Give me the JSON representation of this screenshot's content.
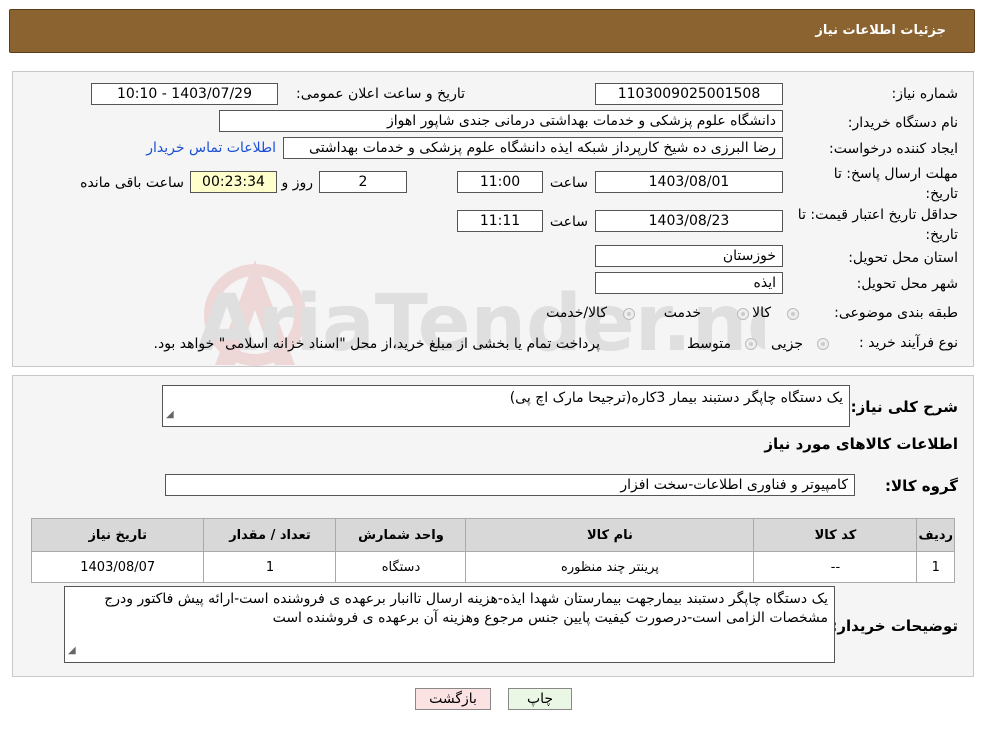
{
  "header": {
    "title": "جزئیات اطلاعات نیاز"
  },
  "labels": {
    "need_number": "شماره نیاز:",
    "announce_datetime": "تاریخ و ساعت اعلان عمومی:",
    "buyer_org": "نام دستگاه خریدار:",
    "requester": "ایجاد کننده درخواست:",
    "reply_deadline": "مهلت ارسال پاسخ: تا تاریخ:",
    "price_validity": "حداقل تاریخ اعتبار قیمت: تا تاریخ:",
    "delivery_province": "استان محل تحویل:",
    "delivery_city": "شهر محل تحویل:",
    "category": "طبقه بندی موضوعی:",
    "purchase_type": "نوع فرآیند خرید :",
    "hour": "ساعت",
    "day_and": "روز و",
    "remaining": "ساعت باقی مانده",
    "general_desc": "شرح کلی نیاز:",
    "goods_info": "اطلاعات کالاهای مورد نیاز",
    "goods_group": "گروه کالا:",
    "buyer_notes": "توضیحات خریدار:"
  },
  "fields": {
    "need_number": "1103009025001508",
    "announce_datetime": "1403/07/29 - 10:10",
    "buyer_org": "دانشگاه علوم پزشکی و خدمات بهداشتی درمانی جندی شاپور اهواز",
    "requester": "رضا البرزی ده شیخ کارپرداز شبکه ایذه دانشگاه علوم پزشکی و خدمات بهداشتی",
    "contact_link": "اطلاعات تماس خریدار",
    "reply_date": "1403/08/01",
    "reply_time": "11:00",
    "days": "2",
    "remaining_time": "00:23:34",
    "validity_date": "1403/08/23",
    "validity_time": "11:11",
    "province": "خوزستان",
    "city": "ایذه",
    "general_desc": "یک دستگاه چاپگر دستبند بیمار 3کاره(ترجیحا مارک اچ پی)",
    "goods_group": "کامپیوتر و فناوری اطلاعات-سخت افزار",
    "buyer_notes": "یک دستگاه چاپگر دستبند بیمارجهت بیمارستان شهدا ایذه-هزینه ارسال تاانبار برعهده ی فروشنده است-ارائه پیش فاکتور ودرج مشخصات الزامی است-درصورت کیفیت پایین جنس مرجوع وهزینه آن برعهده ی فروشنده است"
  },
  "category_options": [
    "کالا",
    "خدمت",
    "کالا/خدمت"
  ],
  "purchase_options": [
    "جزیی",
    "متوسط"
  ],
  "purchase_note": "پرداخت تمام یا بخشی از مبلغ خرید،از محل \"اسناد خزانه اسلامی\" خواهد بود.",
  "table": {
    "headers": [
      "ردیف",
      "کد کالا",
      "نام کالا",
      "واحد شمارش",
      "تعداد / مقدار",
      "تاریخ نیاز"
    ],
    "rows": [
      [
        "1",
        "--",
        "پرینتر چند منظوره",
        "دستگاه",
        "1",
        "1403/08/07"
      ]
    ]
  },
  "buttons": {
    "print": "چاپ",
    "back": "بازگشت"
  },
  "watermark": "AriaTender.neT",
  "colors": {
    "header_bg": "#8b6330",
    "link": "#1a4fd6",
    "highlight": "#ffffcc",
    "print_btn": "#eaf7e4",
    "back_btn": "#fbe3e3"
  }
}
